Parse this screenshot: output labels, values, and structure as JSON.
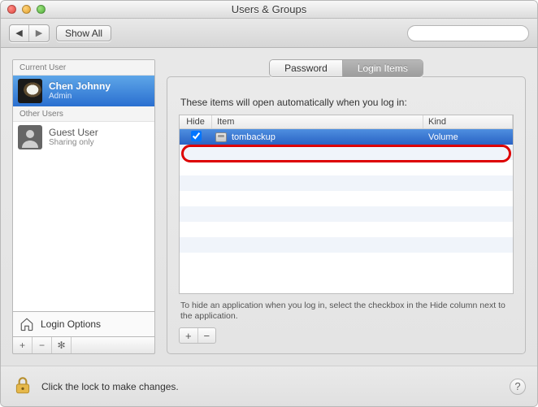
{
  "window": {
    "title": "Users & Groups"
  },
  "toolbar": {
    "show_all_label": "Show All",
    "search_placeholder": ""
  },
  "sidebar": {
    "current_header": "Current User",
    "other_header": "Other Users",
    "users": [
      {
        "name": "Chen Johnny",
        "role": "Admin",
        "selected": true
      },
      {
        "name": "Guest User",
        "role": "Sharing only",
        "selected": false
      }
    ],
    "login_options_label": "Login Options"
  },
  "tabs": {
    "password": "Password",
    "login_items": "Login Items",
    "selected": "login_items"
  },
  "login_items_panel": {
    "intro": "These items will open automatically when you log in:",
    "columns": {
      "hide": "Hide",
      "item": "Item",
      "kind": "Kind"
    },
    "rows": [
      {
        "hide": true,
        "item": "tombackup",
        "kind": "Volume",
        "selected": true
      }
    ],
    "hint": "To hide an application when you log in, select the checkbox in the Hide column next to the application."
  },
  "footer": {
    "lock_message": "Click the lock to make changes."
  }
}
